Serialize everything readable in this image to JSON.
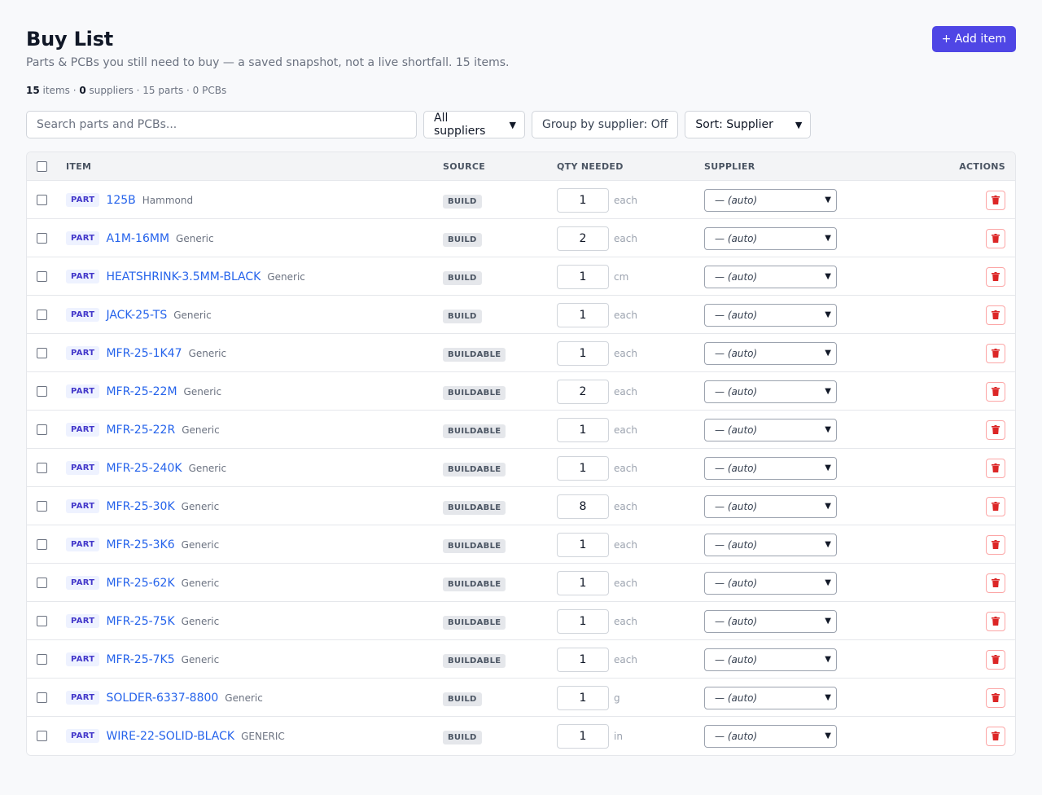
{
  "header": {
    "title": "Buy List",
    "subtitle": "Parts & PCBs you still need to buy — a saved snapshot, not a live shortfall. 15 items.",
    "stats": {
      "items_count": "15",
      "items_label": " items · ",
      "suppliers_count": "0",
      "suppliers_label": " suppliers · 15 parts · 0 PCBs"
    },
    "add_button_label": "+ Add item"
  },
  "toolbar": {
    "search_placeholder": "Search parts and PCBs...",
    "supplier_filter": "All suppliers",
    "group_toggle": "Group by supplier: Off",
    "sort": "Sort: Supplier"
  },
  "table": {
    "columns": {
      "item": "ITEM",
      "source": "SOURCE",
      "qty": "QTY NEEDED",
      "supplier": "SUPPLIER",
      "actions": "ACTIONS"
    },
    "rows": [
      {
        "kind": "PART",
        "name": "125B",
        "mfr": "Hammond",
        "source": "BUILD",
        "qty": "1",
        "unit": "each",
        "supplier": "— (auto)"
      },
      {
        "kind": "PART",
        "name": "A1M-16MM",
        "mfr": "Generic",
        "source": "BUILD",
        "qty": "2",
        "unit": "each",
        "supplier": "— (auto)"
      },
      {
        "kind": "PART",
        "name": "HEATSHRINK-3.5MM-BLACK",
        "mfr": "Generic",
        "source": "BUILD",
        "qty": "1",
        "unit": "cm",
        "supplier": "— (auto)"
      },
      {
        "kind": "PART",
        "name": "JACK-25-TS",
        "mfr": "Generic",
        "source": "BUILD",
        "qty": "1",
        "unit": "each",
        "supplier": "— (auto)"
      },
      {
        "kind": "PART",
        "name": "MFR-25-1K47",
        "mfr": "Generic",
        "source": "BUILDABLE",
        "qty": "1",
        "unit": "each",
        "supplier": "— (auto)"
      },
      {
        "kind": "PART",
        "name": "MFR-25-22M",
        "mfr": "Generic",
        "source": "BUILDABLE",
        "qty": "2",
        "unit": "each",
        "supplier": "— (auto)"
      },
      {
        "kind": "PART",
        "name": "MFR-25-22R",
        "mfr": "Generic",
        "source": "BUILDABLE",
        "qty": "1",
        "unit": "each",
        "supplier": "— (auto)"
      },
      {
        "kind": "PART",
        "name": "MFR-25-240K",
        "mfr": "Generic",
        "source": "BUILDABLE",
        "qty": "1",
        "unit": "each",
        "supplier": "— (auto)"
      },
      {
        "kind": "PART",
        "name": "MFR-25-30K",
        "mfr": "Generic",
        "source": "BUILDABLE",
        "qty": "8",
        "unit": "each",
        "supplier": "— (auto)"
      },
      {
        "kind": "PART",
        "name": "MFR-25-3K6",
        "mfr": "Generic",
        "source": "BUILDABLE",
        "qty": "1",
        "unit": "each",
        "supplier": "— (auto)"
      },
      {
        "kind": "PART",
        "name": "MFR-25-62K",
        "mfr": "Generic",
        "source": "BUILDABLE",
        "qty": "1",
        "unit": "each",
        "supplier": "— (auto)"
      },
      {
        "kind": "PART",
        "name": "MFR-25-75K",
        "mfr": "Generic",
        "source": "BUILDABLE",
        "qty": "1",
        "unit": "each",
        "supplier": "— (auto)"
      },
      {
        "kind": "PART",
        "name": "MFR-25-7K5",
        "mfr": "Generic",
        "source": "BUILDABLE",
        "qty": "1",
        "unit": "each",
        "supplier": "— (auto)"
      },
      {
        "kind": "PART",
        "name": "SOLDER-6337-8800",
        "mfr": "Generic",
        "source": "BUILD",
        "qty": "1",
        "unit": "g",
        "supplier": "— (auto)"
      },
      {
        "kind": "PART",
        "name": "WIRE-22-SOLID-BLACK",
        "mfr": "GENERIC",
        "source": "BUILD",
        "qty": "1",
        "unit": "in",
        "supplier": "— (auto)"
      }
    ]
  },
  "icons": {
    "row_action": "trash-icon",
    "select_chevron": "chevron-down-icon"
  },
  "colors": {
    "accent": "#4f46e5",
    "link": "#2563eb",
    "danger": "#dc2626",
    "part_badge_bg": "#eef2ff",
    "part_badge_text": "#4338ca"
  }
}
